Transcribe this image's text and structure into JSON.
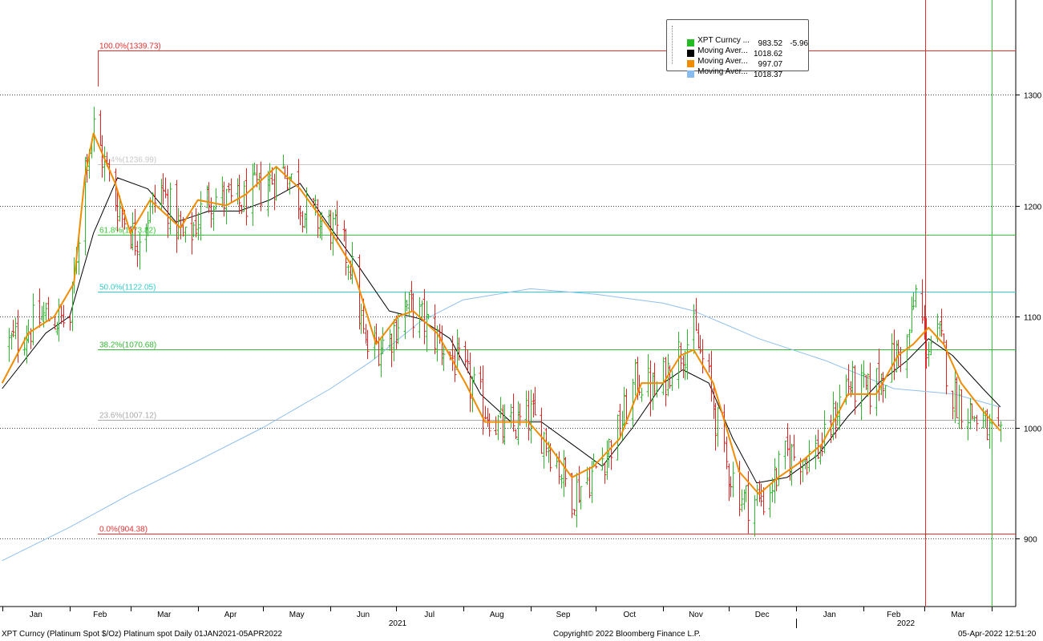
{
  "chart_data": {
    "type": "ohlc",
    "title": "XPT Curncy (Platinum Spot  $/Oz) Platinum spot  Daily 01JAN2021-05APR2022",
    "ylim": [
      840,
      1375
    ],
    "y_ticks": [
      900,
      1000,
      1100,
      1200,
      1300
    ],
    "x_month_labels": [
      "Jan",
      "Feb",
      "Mar",
      "Apr",
      "May",
      "Jun",
      "Jul",
      "Aug",
      "Sep",
      "Oct",
      "Nov",
      "Dec",
      "Jan",
      "Feb",
      "Mar"
    ],
    "x_year_labels": [
      "2021",
      "2022"
    ],
    "grid": "horizontal-dotted",
    "legend_placement": "top-right",
    "fibonacci": [
      {
        "label": "100.0%(1339.73)",
        "value": 1339.73,
        "color": "#e03030"
      },
      {
        "label": "76.4%(1236.99)",
        "value": 1236.99,
        "color": "#c8c8c8"
      },
      {
        "label": "61.8%(1173.82)",
        "value": 1173.82,
        "color": "#33cc33"
      },
      {
        "label": "50.0%(1122.05)",
        "value": 1122.05,
        "color": "#33cccc"
      },
      {
        "label": "38.2%(1070.68)",
        "value": 1070.68,
        "color": "#33bb33"
      },
      {
        "label": "23.6%(1007.12)",
        "value": 1007.12,
        "color": "#aaaaaa"
      },
      {
        "label": "0.0%(904.38)",
        "value": 904.38,
        "color": "#e03030"
      }
    ],
    "legend": [
      {
        "name": "XPT Curncy ...",
        "value": "983.52",
        "change": "-5.96",
        "color": "#22bb22"
      },
      {
        "name": "Moving Aver...",
        "value": "1018.62",
        "change": "",
        "color": "#000000"
      },
      {
        "name": "Moving Aver...",
        "value": "997.07",
        "change": "",
        "color": "#f08c00"
      },
      {
        "name": "Moving Aver...",
        "value": "1018.37",
        "change": "",
        "color": "#88bbee"
      }
    ],
    "close_anchors": [
      [
        "2021-01-04",
        1075
      ],
      [
        "2021-01-20",
        1100
      ],
      [
        "2021-02-01",
        1095
      ],
      [
        "2021-02-08",
        1240
      ],
      [
        "2021-02-12",
        1270
      ],
      [
        "2021-02-22",
        1205
      ],
      [
        "2021-03-03",
        1170
      ],
      [
        "2021-03-15",
        1215
      ],
      [
        "2021-03-26",
        1165
      ],
      [
        "2021-04-06",
        1210
      ],
      [
        "2021-04-19",
        1200
      ],
      [
        "2021-04-30",
        1215
      ],
      [
        "2021-05-11",
        1235
      ],
      [
        "2021-05-20",
        1195
      ],
      [
        "2021-06-01",
        1180
      ],
      [
        "2021-06-10",
        1150
      ],
      [
        "2021-06-17",
        1070
      ],
      [
        "2021-06-28",
        1080
      ],
      [
        "2021-07-05",
        1110
      ],
      [
        "2021-07-14",
        1095
      ],
      [
        "2021-07-28",
        1060
      ],
      [
        "2021-08-10",
        1020
      ],
      [
        "2021-08-20",
        995
      ],
      [
        "2021-09-01",
        1010
      ],
      [
        "2021-09-08",
        990
      ],
      [
        "2021-09-20",
        940
      ],
      [
        "2021-09-30",
        960
      ],
      [
        "2021-10-11",
        995
      ],
      [
        "2021-10-20",
        1045
      ],
      [
        "2021-10-29",
        1030
      ],
      [
        "2021-11-05",
        1060
      ],
      [
        "2021-11-15",
        1085
      ],
      [
        "2021-11-22",
        1040
      ],
      [
        "2021-11-29",
        970
      ],
      [
        "2021-12-08",
        935
      ],
      [
        "2021-12-17",
        935
      ],
      [
        "2021-12-28",
        975
      ],
      [
        "2022-01-07",
        975
      ],
      [
        "2022-01-14",
        985
      ],
      [
        "2022-01-24",
        1040
      ],
      [
        "2022-02-03",
        1030
      ],
      [
        "2022-02-14",
        1060
      ],
      [
        "2022-02-21",
        1075
      ],
      [
        "2022-02-25",
        1120
      ],
      [
        "2022-03-02",
        1075
      ],
      [
        "2022-03-08",
        1080
      ],
      [
        "2022-03-14",
        1030
      ],
      [
        "2022-03-24",
        1010
      ],
      [
        "2022-04-05",
        983.52
      ]
    ],
    "ma_black": [
      [
        "2021-01-01",
        1035
      ],
      [
        "2021-01-21",
        1085
      ],
      [
        "2021-02-01",
        1100
      ],
      [
        "2021-02-12",
        1175
      ],
      [
        "2021-02-23",
        1225
      ],
      [
        "2021-03-09",
        1215
      ],
      [
        "2021-03-22",
        1185
      ],
      [
        "2021-04-06",
        1195
      ],
      [
        "2021-04-20",
        1195
      ],
      [
        "2021-05-04",
        1205
      ],
      [
        "2021-05-18",
        1220
      ],
      [
        "2021-06-01",
        1180
      ],
      [
        "2021-06-14",
        1145
      ],
      [
        "2021-06-28",
        1105
      ],
      [
        "2021-07-12",
        1098
      ],
      [
        "2021-07-26",
        1080
      ],
      [
        "2021-08-09",
        1030
      ],
      [
        "2021-08-23",
        1005
      ],
      [
        "2021-09-06",
        1005
      ],
      [
        "2021-09-20",
        985
      ],
      [
        "2021-10-04",
        965
      ],
      [
        "2021-10-18",
        1000
      ],
      [
        "2021-11-01",
        1040
      ],
      [
        "2021-11-10",
        1052
      ],
      [
        "2021-11-22",
        1040
      ],
      [
        "2021-12-03",
        990
      ],
      [
        "2021-12-14",
        950
      ],
      [
        "2021-12-28",
        955
      ],
      [
        "2022-01-11",
        975
      ],
      [
        "2022-01-25",
        1010
      ],
      [
        "2022-02-08",
        1040
      ],
      [
        "2022-02-21",
        1060
      ],
      [
        "2022-03-03",
        1080
      ],
      [
        "2022-03-14",
        1065
      ],
      [
        "2022-03-28",
        1035
      ],
      [
        "2022-04-05",
        1018.62
      ]
    ],
    "ma_orange": [
      [
        "2021-01-01",
        1040
      ],
      [
        "2021-01-13",
        1085
      ],
      [
        "2021-01-25",
        1100
      ],
      [
        "2021-02-03",
        1130
      ],
      [
        "2021-02-08",
        1225
      ],
      [
        "2021-02-12",
        1265
      ],
      [
        "2021-02-22",
        1220
      ],
      [
        "2021-03-01",
        1175
      ],
      [
        "2021-03-10",
        1205
      ],
      [
        "2021-03-24",
        1180
      ],
      [
        "2021-04-01",
        1205
      ],
      [
        "2021-04-14",
        1200
      ],
      [
        "2021-04-23",
        1210
      ],
      [
        "2021-05-07",
        1235
      ],
      [
        "2021-05-18",
        1215
      ],
      [
        "2021-05-31",
        1180
      ],
      [
        "2021-06-11",
        1145
      ],
      [
        "2021-06-22",
        1075
      ],
      [
        "2021-07-02",
        1100
      ],
      [
        "2021-07-09",
        1105
      ],
      [
        "2021-07-20",
        1085
      ],
      [
        "2021-08-02",
        1040
      ],
      [
        "2021-08-11",
        1005
      ],
      [
        "2021-08-20",
        1005
      ],
      [
        "2021-08-31",
        1005
      ],
      [
        "2021-09-09",
        985
      ],
      [
        "2021-09-20",
        955
      ],
      [
        "2021-09-30",
        965
      ],
      [
        "2021-10-12",
        990
      ],
      [
        "2021-10-22",
        1040
      ],
      [
        "2021-11-01",
        1040
      ],
      [
        "2021-11-09",
        1065
      ],
      [
        "2021-11-15",
        1070
      ],
      [
        "2021-11-24",
        1040
      ],
      [
        "2021-12-06",
        960
      ],
      [
        "2021-12-15",
        940
      ],
      [
        "2021-12-24",
        955
      ],
      [
        "2022-01-04",
        970
      ],
      [
        "2022-01-13",
        985
      ],
      [
        "2022-01-25",
        1030
      ],
      [
        "2022-02-07",
        1030
      ],
      [
        "2022-02-17",
        1065
      ],
      [
        "2022-02-24",
        1075
      ],
      [
        "2022-03-03",
        1090
      ],
      [
        "2022-03-10",
        1075
      ],
      [
        "2022-03-18",
        1040
      ],
      [
        "2022-03-28",
        1015
      ],
      [
        "2022-04-05",
        997.07
      ]
    ],
    "ma_blue": [
      [
        "2021-01-01",
        880
      ],
      [
        "2021-02-01",
        910
      ],
      [
        "2021-03-01",
        940
      ],
      [
        "2021-04-01",
        970
      ],
      [
        "2021-05-01",
        1000
      ],
      [
        "2021-06-01",
        1035
      ],
      [
        "2021-06-20",
        1060
      ],
      [
        "2021-07-12",
        1095
      ],
      [
        "2021-08-01",
        1115
      ],
      [
        "2021-09-01",
        1125
      ],
      [
        "2021-10-01",
        1120
      ],
      [
        "2021-11-01",
        1112
      ],
      [
        "2021-11-15",
        1105
      ],
      [
        "2021-12-15",
        1080
      ],
      [
        "2022-01-15",
        1060
      ],
      [
        "2022-02-15",
        1035
      ],
      [
        "2022-03-15",
        1030
      ],
      [
        "2022-04-05",
        1018.37
      ]
    ]
  },
  "footer": {
    "left": "XPT Curncy (Platinum Spot  $/Oz) Platinum spot  Daily 01JAN2021-05APR2022",
    "center": "Copyright© 2022 Bloomberg Finance L.P.",
    "right": "05-Apr-2022 12:51:20"
  }
}
